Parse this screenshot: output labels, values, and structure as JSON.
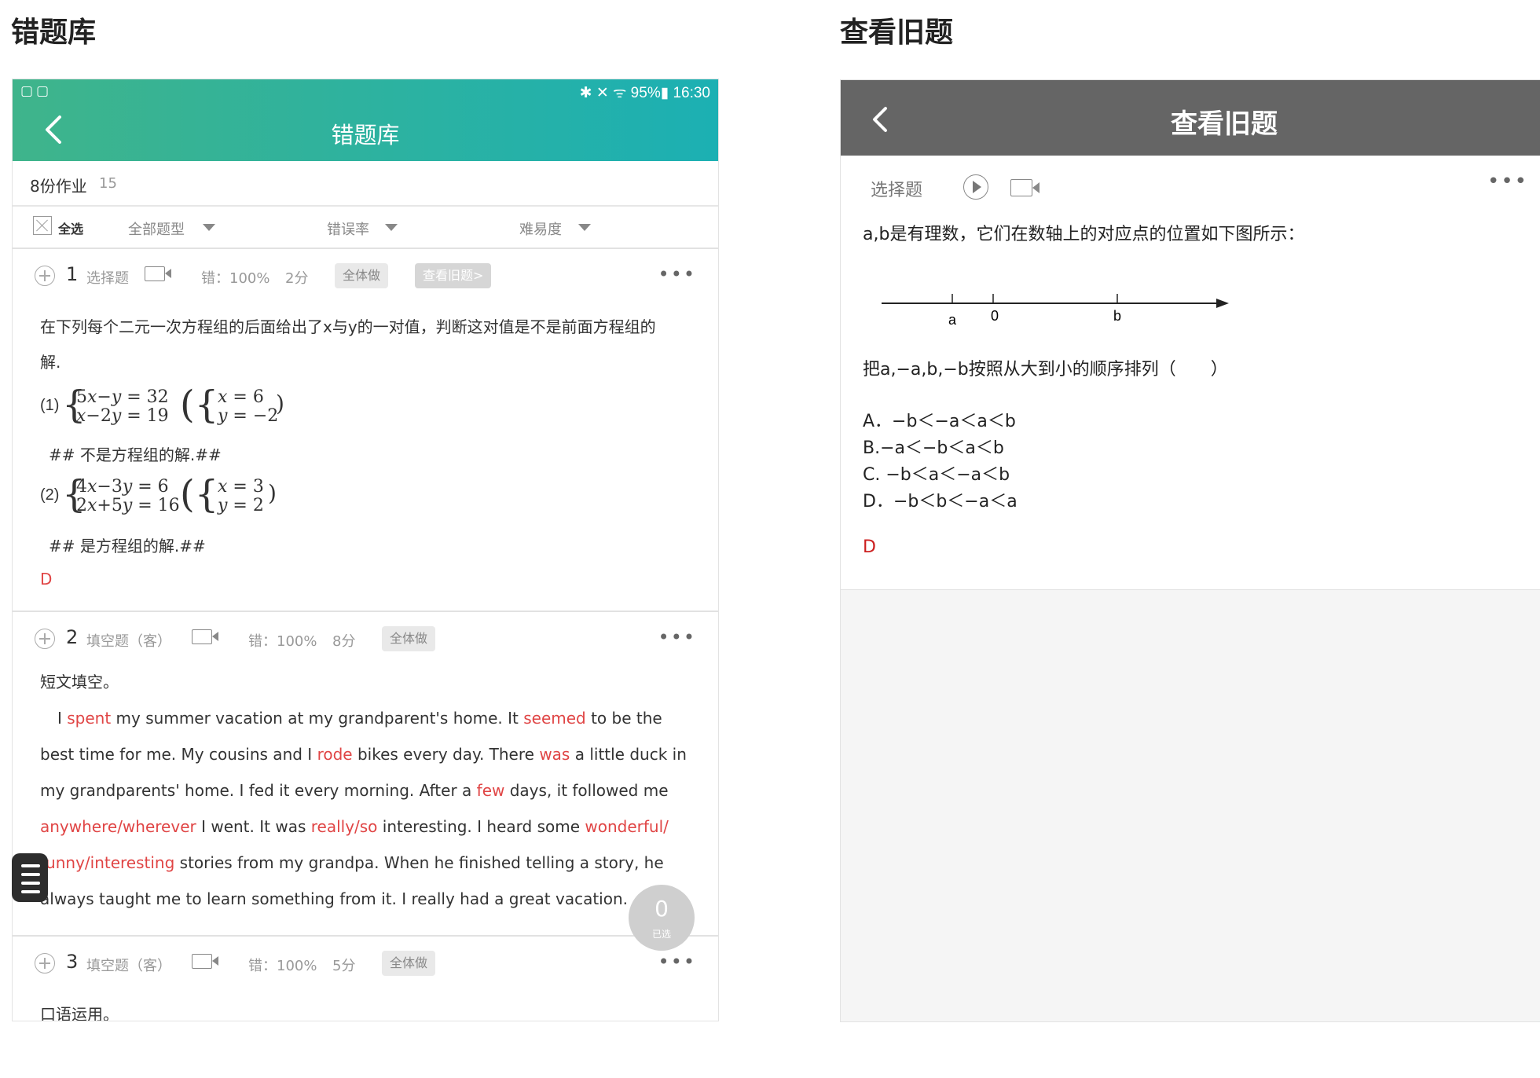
{
  "left_section": {
    "title": "错题库"
  },
  "right_section": {
    "title": "查看旧题"
  },
  "left_phone": {
    "status_left": "▢▢",
    "status_right": "✱ ✕ ᯤ 95%▮ 16:30",
    "header_title": "错题库",
    "homework": {
      "label": "8份作业",
      "count": "15"
    },
    "filters": {
      "select_all": "全选",
      "type": "全部题型",
      "error_rate": "错误率",
      "difficulty": "难易度"
    },
    "questions": [
      {
        "num": "1",
        "type": "选择题",
        "error": "错：100%",
        "points": "2分",
        "class_btn": "全体做",
        "old_btn": "查看旧题>",
        "more": "•••",
        "line1": "在下列每个二元一次方程组的后面给出了x与y的一对值，判断这对值是不是前面方程组的",
        "line2": "解.",
        "sys1_label": "(1)",
        "sys1_eq1": "5𝑥−𝑦 = 32",
        "sys1_eq2": "𝑥−2𝑦 = 19",
        "sys1_val1": "𝑥 = 6",
        "sys1_val2": "𝑦 = −2",
        "hash1": "##  不是方程组的解.##",
        "sys2_label": "(2)",
        "sys2_eq1": "4𝑥−3𝑦 = 6",
        "sys2_eq2": "2𝑥+5𝑦 = 16",
        "sys2_val1": "𝑥 = 3",
        "sys2_val2": "𝑦 = 2",
        "hash2": "##  是方程组的解.##",
        "answer": "D"
      },
      {
        "num": "2",
        "type": "填空题（客）",
        "error": "错：100%",
        "points": "8分",
        "class_btn": "全体做",
        "more": "•••",
        "title": "短文填空。",
        "p1_a": "I ",
        "p1_b": "spent",
        "p1_c": " my summer vacation at my grandparent's home. It ",
        "p1_d": "seemed",
        "p1_e": " to be the",
        "p2_a": "best time for me. My cousins and I ",
        "p2_b": "rode",
        "p2_c": " bikes every day. There ",
        "p2_d": "was",
        "p2_e": " a little duck in",
        "p3_a": "my grandparents' home. I fed it every morning. After a ",
        "p3_b": "few",
        "p3_c": " days, it followed me",
        "p4_a": "anywhere/wherever",
        "p4_b": " I went. It was ",
        "p4_c": "really/so",
        "p4_d": " interesting. I heard some ",
        "p4_e": "wonderful/",
        "p5_a": "funny/interesting",
        "p5_b": " stories from my grandpa. When he finished telling a story, he",
        "p6_a": "always taught me to learn something from it. I really had a great vacation."
      },
      {
        "num": "3",
        "type": "填空题（客）",
        "error": "错：100%",
        "points": "5分",
        "class_btn": "全体做",
        "more": "•••",
        "title": "口语运用。"
      }
    ],
    "float_count": {
      "num": "0",
      "label": "已选"
    }
  },
  "right_phone": {
    "header_title": "查看旧题",
    "type": "选择题",
    "more": "•••",
    "stem": "a,b是有理数，它们在数轴上的对应点的位置如下图所示：",
    "numberline": {
      "label_a": "a",
      "label_0": "0",
      "label_b": "b"
    },
    "instruction": "把a,−a,b,−b按照从大到小的顺序排列（　　）",
    "options": [
      "A．−b＜−a＜a＜b",
      "B.−a＜−b＜a＜b",
      "C. −b＜a＜−a＜b",
      "D．−b＜b＜−a＜a"
    ],
    "answer": "D"
  }
}
